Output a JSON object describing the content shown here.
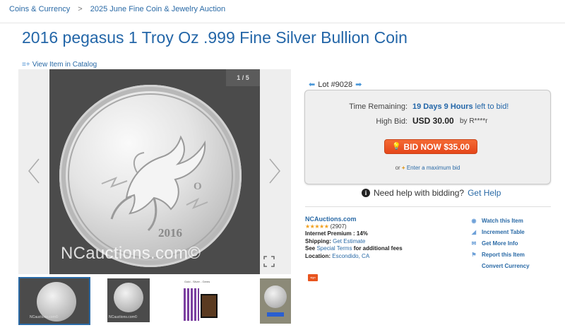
{
  "breadcrumb": {
    "root": "Coins & Currency",
    "separator": ">",
    "current": "2025 June Fine Coin & Jewelry Auction"
  },
  "page": {
    "title": "2016 pegasus 1 Troy Oz .999 Fine Silver Bullion Coin"
  },
  "catalog": {
    "link": "View Item in Catalog"
  },
  "gallery": {
    "counter": "1 / 5",
    "watermark": "NCauctions.com©",
    "coin_year": "2016",
    "thumb_watermark": "NCauctions.com©",
    "thumb3_caption": "Gold - Silver - Gems"
  },
  "lot": {
    "label": "Lot #9028"
  },
  "bid": {
    "time_label": "Time Remaining:",
    "time_value": "19 Days 9 Hours",
    "time_tail": "left to bid!",
    "high_label": "High Bid:",
    "high_value": "USD 30.00",
    "high_by": "by R****r",
    "button": "BID NOW $35.00",
    "or_text": "or",
    "max_link": "Enter a maximum bid"
  },
  "help": {
    "text": "Need help with bidding?",
    "link": "Get Help"
  },
  "seller": {
    "name": "NCAuctions.com",
    "stars": "★★★★★",
    "rating_count": "(2907)",
    "premium": "Internet Premium : 14%",
    "shipping_label": "Shipping:",
    "shipping_link": "Get Estimate",
    "terms_prefix": "See",
    "terms_link": "Special Terms",
    "terms_suffix": "for additional fees",
    "location_label": "Location:",
    "location_value": "Escondido, CA",
    "badge": "sign"
  },
  "actions": {
    "watch": "Watch this Item",
    "increment": "Increment Table",
    "info": "Get More Info",
    "report": "Report this Item",
    "currency": "Convert Currency"
  },
  "colors": {
    "link": "#2a6aa6",
    "title": "#2366a8",
    "bid_button": "#e5461a"
  }
}
